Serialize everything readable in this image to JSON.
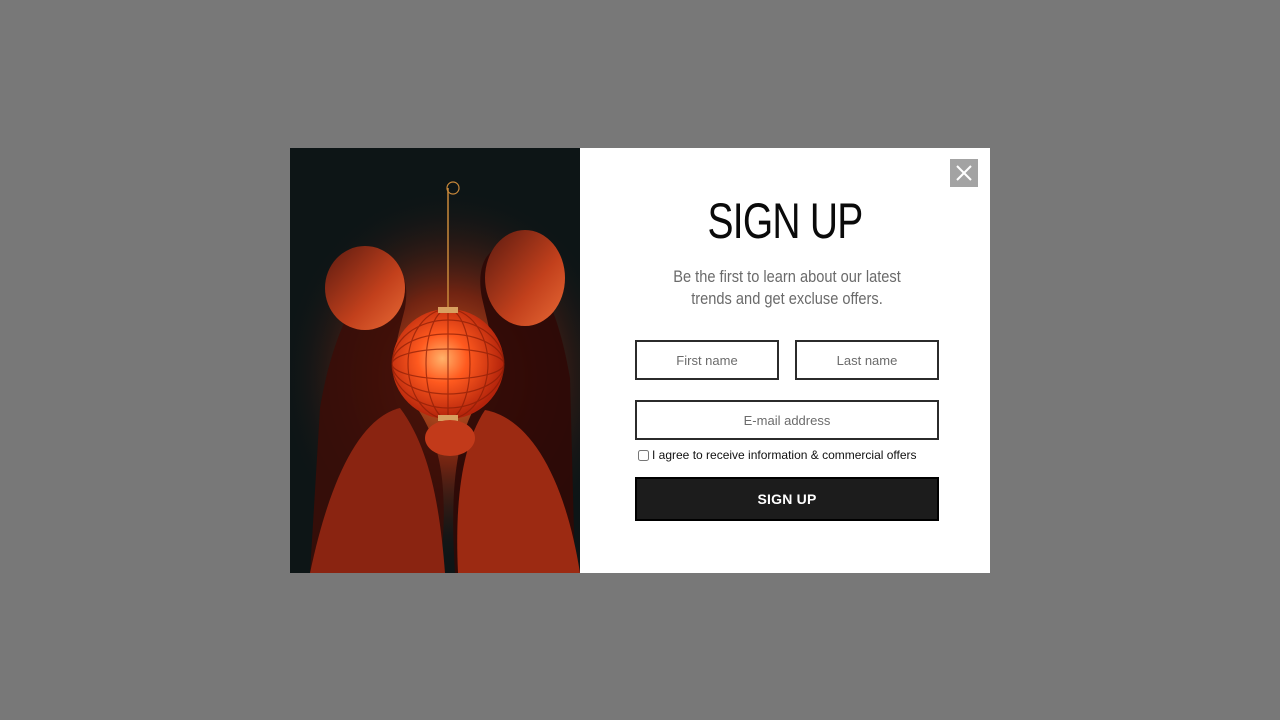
{
  "popup": {
    "title": "SIGN UP",
    "subtitle_line1": "Be the first to learn about our latest",
    "subtitle_line2": "trends and get excluse offers.",
    "first_name_placeholder": "First name",
    "last_name_placeholder": "Last name",
    "email_placeholder": "E-mail address",
    "consent_label": "I agree to receive information & commercial offers",
    "consent_checked": false,
    "submit_label": "SIGN UP",
    "close_icon": "close-icon",
    "image_subject": "lantern-photo"
  },
  "colors": {
    "overlay": "#787878",
    "panel": "#ffffff",
    "button": "#1c1c1c",
    "close_button": "#a3a3a3",
    "lantern": "#ff5a1f"
  }
}
